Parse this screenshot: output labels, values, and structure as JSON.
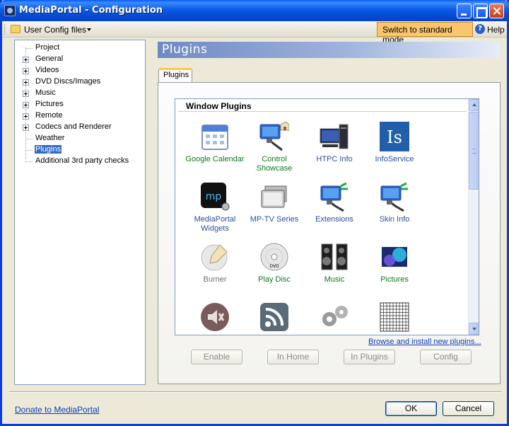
{
  "window": {
    "title": "MediaPortal - Configuration"
  },
  "toolbar": {
    "config_files_label": "User Config files",
    "switch_mode_label": "Switch to standard mode",
    "help_label": "Help"
  },
  "tree": {
    "items": [
      {
        "label": "Project",
        "expandable": false
      },
      {
        "label": "General",
        "expandable": true
      },
      {
        "label": "Videos",
        "expandable": true
      },
      {
        "label": "DVD Discs/Images",
        "expandable": true
      },
      {
        "label": "Music",
        "expandable": true
      },
      {
        "label": "Pictures",
        "expandable": true
      },
      {
        "label": "Remote",
        "expandable": true
      },
      {
        "label": "Codecs and Renderer",
        "expandable": true
      },
      {
        "label": "Weather",
        "expandable": false
      },
      {
        "label": "Plugins",
        "expandable": false,
        "selected": true
      },
      {
        "label": "Additional 3rd party checks",
        "expandable": false
      }
    ]
  },
  "page": {
    "header": "Plugins"
  },
  "tabs": [
    {
      "label": "Plugins"
    }
  ],
  "plugins": {
    "group_title": "Window Plugins",
    "items": [
      {
        "label": "Google Calendar",
        "status": "enabled",
        "icon": "calendar-icon"
      },
      {
        "label": "Control Showcase",
        "status": "enabled",
        "icon": "monitor-plug-home-icon"
      },
      {
        "label": "HTPC Info",
        "status": "incomplete",
        "icon": "htpc-computer-icon"
      },
      {
        "label": "InfoService",
        "status": "incomplete",
        "icon": "infoservice-icon"
      },
      {
        "label": "MediaPortal Widgets",
        "status": "incomplete",
        "icon": "mediaportal-widgets-icon"
      },
      {
        "label": "MP-TV Series",
        "status": "incomplete",
        "icon": "tv-series-icon"
      },
      {
        "label": "Extensions",
        "status": "incomplete",
        "icon": "monitor-plug-icon"
      },
      {
        "label": "Skin Info",
        "status": "incomplete",
        "icon": "monitor-plug-icon"
      },
      {
        "label": "Burner",
        "status": "disabled",
        "icon": "disc-pencil-icon"
      },
      {
        "label": "Play Disc",
        "status": "enabled",
        "icon": "dvd-disc-icon"
      },
      {
        "label": "Music",
        "status": "enabled",
        "icon": "speakers-icon"
      },
      {
        "label": "Pictures",
        "status": "enabled",
        "icon": "picture-icon"
      },
      {
        "label": "",
        "status": "disabled",
        "icon": "speaker-muted-icon"
      },
      {
        "label": "",
        "status": "enabled",
        "icon": "rss-feed-icon"
      },
      {
        "label": "",
        "status": "disabled",
        "icon": "gears-icon"
      },
      {
        "label": "",
        "status": "enabled",
        "icon": "sudoku-grid-icon"
      }
    ]
  },
  "browse_link": "Browse and install new plugins...",
  "actions": {
    "enable": "Enable",
    "in_home": "In Home",
    "in_plugins": "In Plugins",
    "config": "Config"
  },
  "footer": {
    "donate_link": "Donate to MediaPortal",
    "ok": "OK",
    "cancel": "Cancel"
  },
  "colors": {
    "enabled_text": "#0c7a1a",
    "incomplete_text": "#2f4d9e",
    "disabled_text": "#707070",
    "switch_button_bg": "#fbc56d",
    "title_bar": "#0a5cf0"
  }
}
